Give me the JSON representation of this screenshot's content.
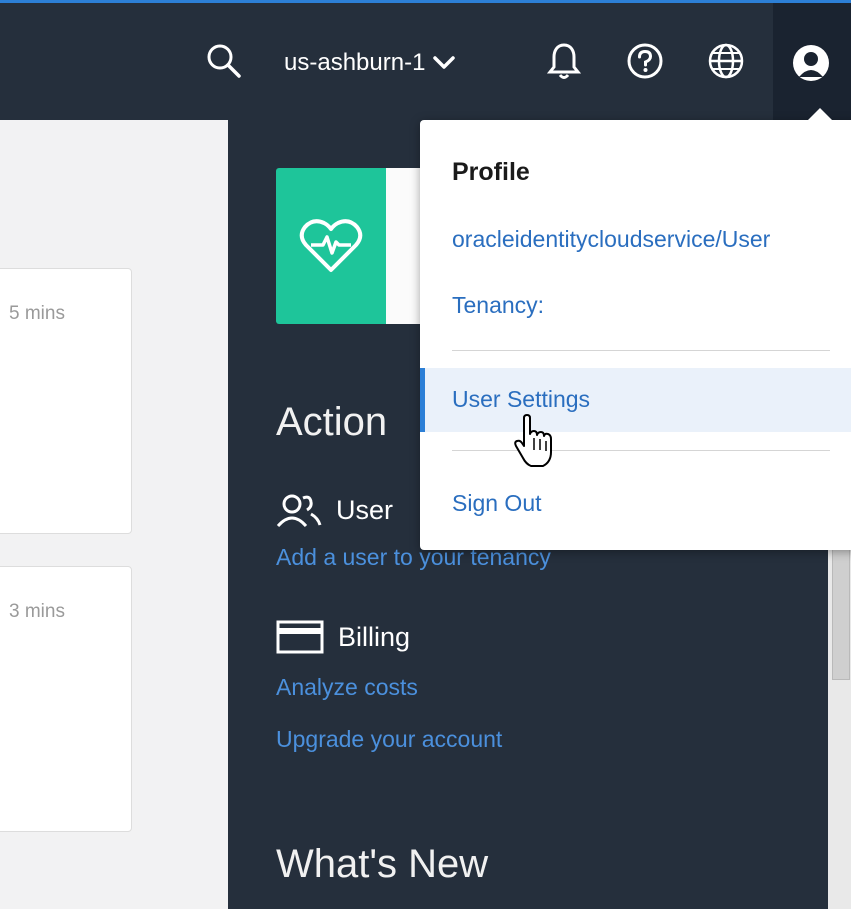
{
  "topbar": {
    "region": "us-ashburn-1",
    "icons": [
      "search-icon",
      "chevron-down-icon",
      "bell-icon",
      "help-icon",
      "globe-icon",
      "user-avatar-icon"
    ]
  },
  "left_cards": [
    {
      "time": "5 mins"
    },
    {
      "time": "3 mins"
    }
  ],
  "actions": {
    "heading": "Action",
    "user_label": "User",
    "user_link": "Add a user to your tenancy",
    "billing_label": "Billing",
    "billing_links": [
      "Analyze costs",
      "Upgrade your account"
    ]
  },
  "whats_new": {
    "heading": "What's New"
  },
  "profile_menu": {
    "title": "Profile",
    "username": "oracleidentitycloudservice/User",
    "tenancy": "Tenancy:",
    "user_settings": "User Settings",
    "sign_out": "Sign Out"
  },
  "colors": {
    "topbar_bg": "#252f3c",
    "link": "#4b90dd",
    "health_tile": "#1ec59a",
    "highlight": "#eaf1fa"
  }
}
